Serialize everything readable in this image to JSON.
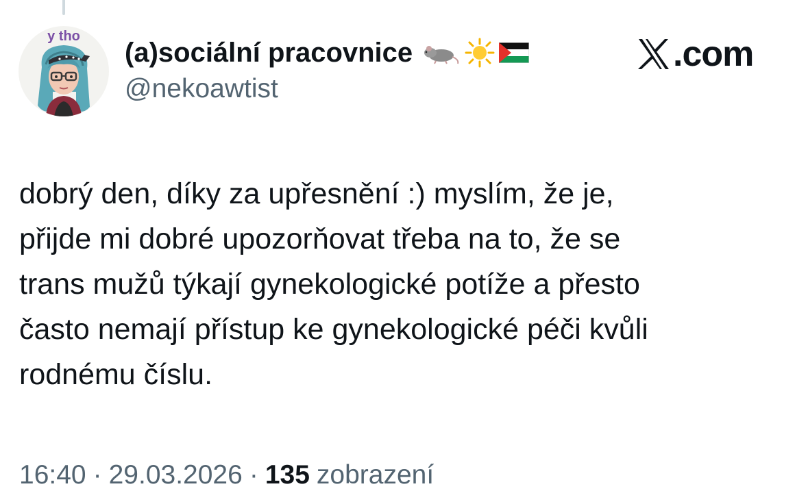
{
  "avatar": {
    "caption": "y tho",
    "accent_color": "#7b4fa6",
    "hair_color": "#5aa9b8"
  },
  "author": {
    "display_name": "(a)sociální pracovnice",
    "badges": [
      "rat-emoji",
      "sun-emoji",
      "palestine-flag-emoji"
    ],
    "handle": "@nekoawtist"
  },
  "brand": {
    "label": ".com",
    "logo_icon": "x-logo-icon"
  },
  "tweet": {
    "lines": [
      "dobrý den, díky za upřesnění :) myslím, že je,",
      "přijde mi dobré upozorňovat třeba na to, že se",
      "trans mužů týkají gynekologické potíže a přesto",
      "často nemají přístup ke gynekologické péči kvůli",
      "rodnému číslu."
    ]
  },
  "meta": {
    "time": "16:40",
    "separator": "·",
    "date": "29.03.2026",
    "views_count": "135",
    "views_label": "zobrazení"
  },
  "colors": {
    "text_primary": "#0f1419",
    "text_secondary": "#536471",
    "thread_line": "#cfd9de"
  }
}
